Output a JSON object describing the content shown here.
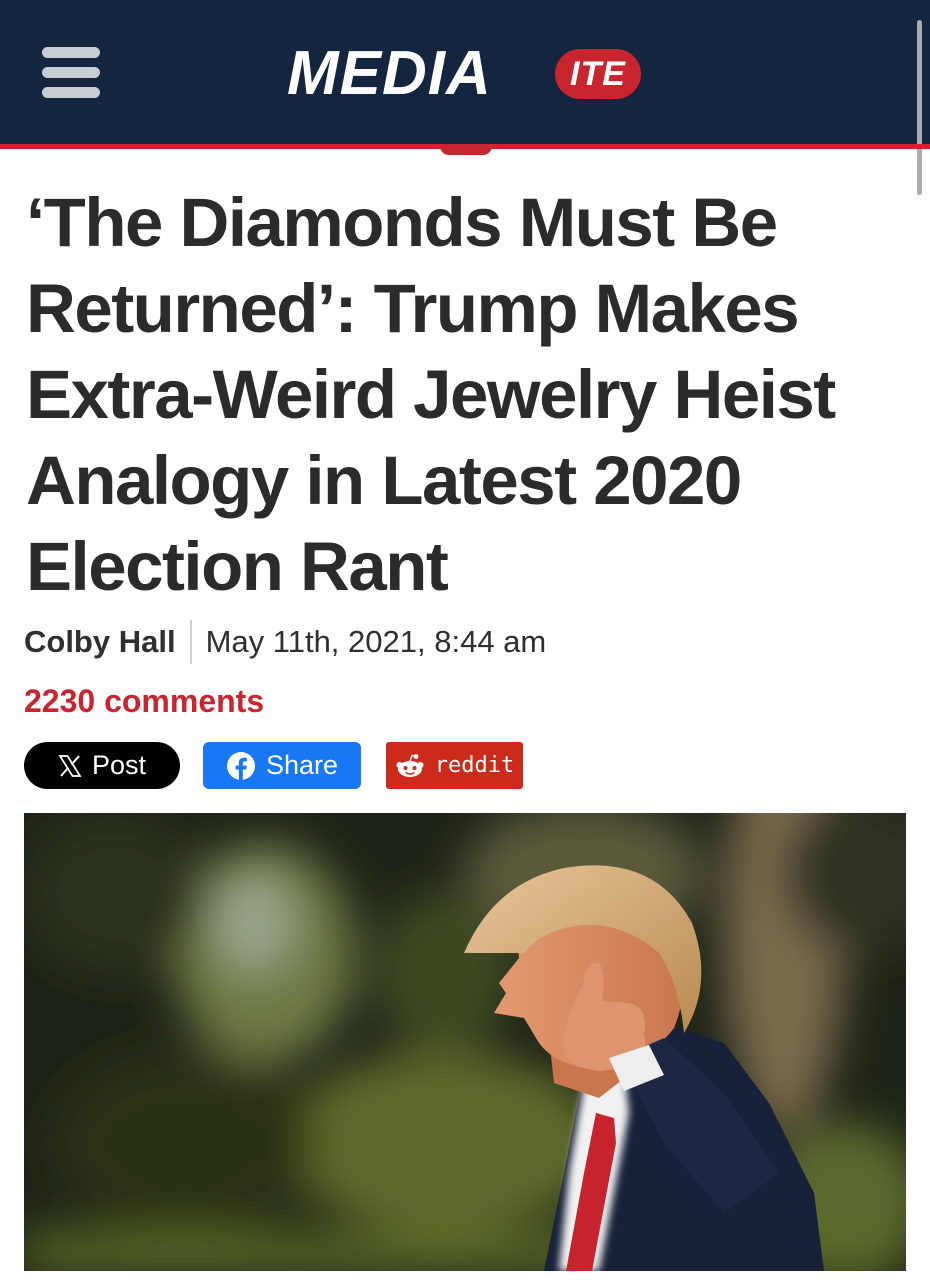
{
  "header": {
    "logo_main": "MEDIA",
    "logo_pill": "ITE",
    "menu_icon": "hamburger-menu-icon"
  },
  "article": {
    "headline": "‘The Diamonds Must Be Returned’: Trump Makes Extra-Weird Jewelry Heist Analogy in Latest 2020 Election Rant",
    "author": "Colby Hall",
    "date": "May 11th, 2021, 8:44 am",
    "comments": "2230 comments"
  },
  "share": {
    "x_label": "Post",
    "facebook_label": "Share",
    "reddit_label": "reddit"
  },
  "colors": {
    "header_bg": "#13253f",
    "brand_red": "#c9252f",
    "facebook_blue": "#1877f2",
    "reddit_red": "#cc2a1a",
    "headline_text": "#2b2b2b"
  }
}
